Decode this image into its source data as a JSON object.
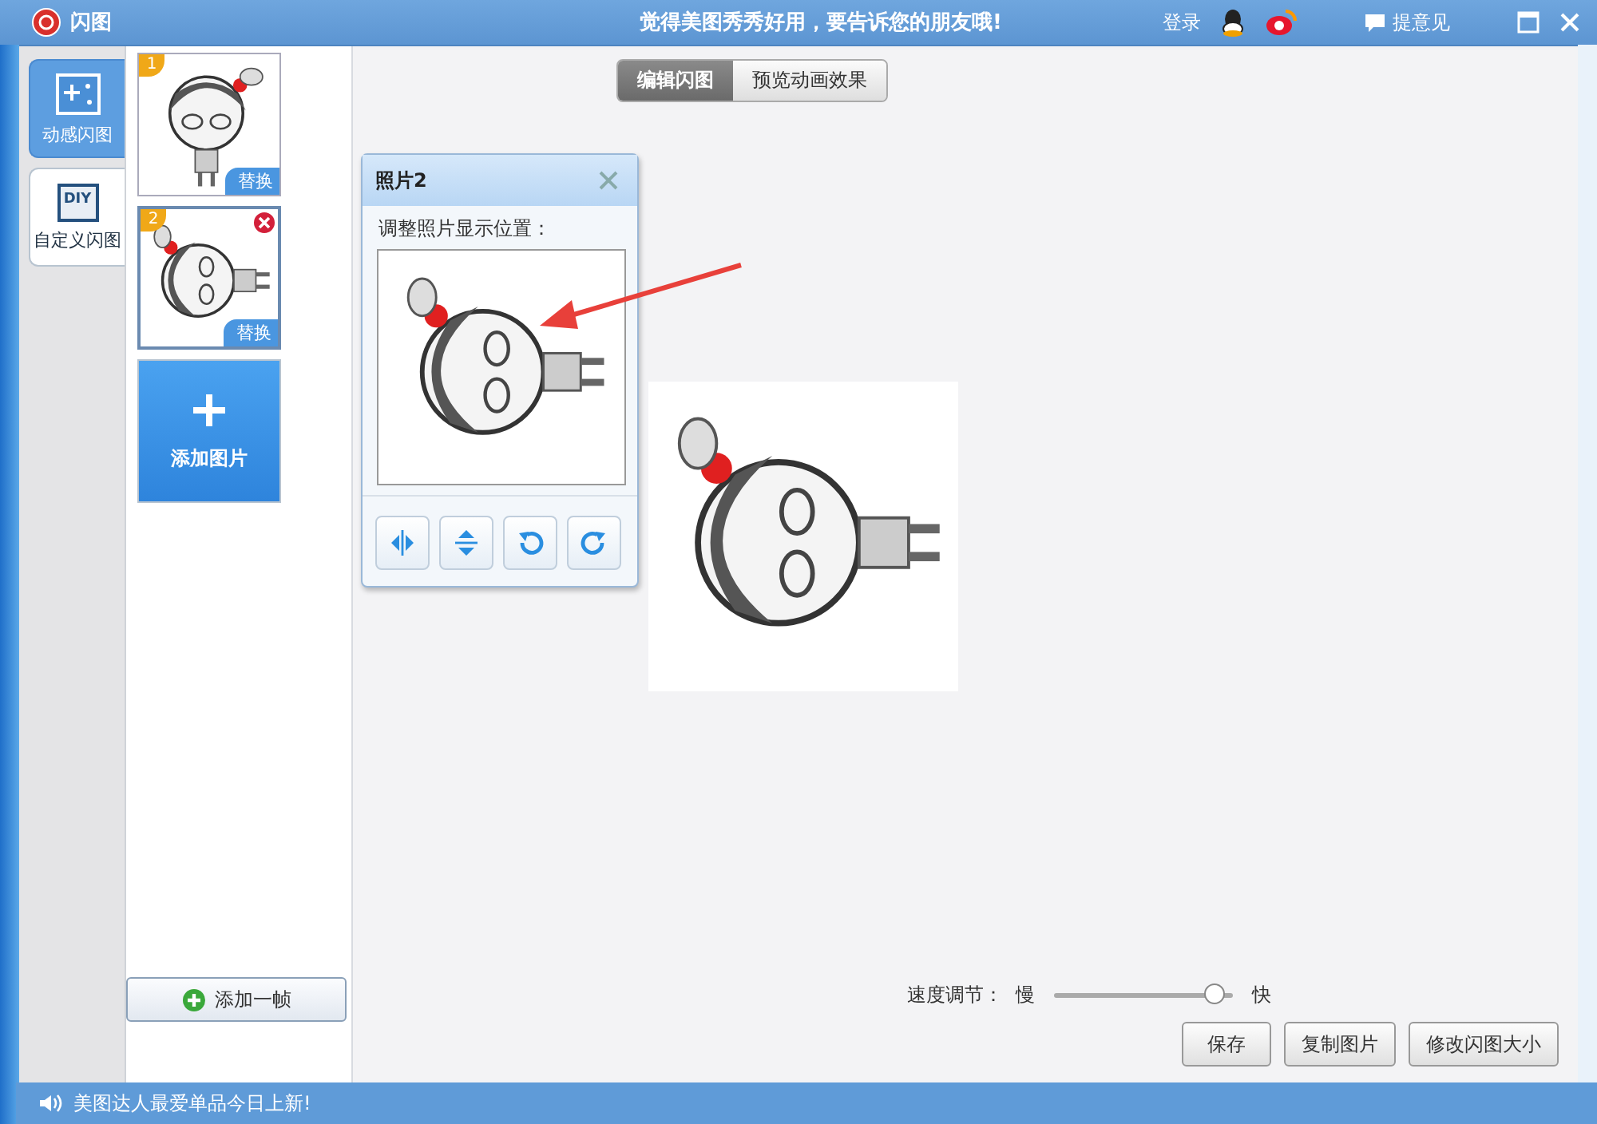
{
  "window": {
    "title": "闪图",
    "slogan": "觉得美图秀秀好用，要告诉您的朋友哦!",
    "login": "登录",
    "feedback": "提意见"
  },
  "mode_tabs": [
    {
      "label": "动感闪图",
      "selected": true,
      "kind": "sparkle"
    },
    {
      "label": "自定义闪图",
      "selected": false,
      "kind": "diy",
      "icon_text": "DIY"
    }
  ],
  "frames": [
    {
      "number": "1",
      "replace": "替换",
      "selected": false
    },
    {
      "number": "2",
      "replace": "替换",
      "selected": true
    }
  ],
  "add_image": "添加图片",
  "add_frame": "添加一帧",
  "view_tabs": [
    {
      "label": "编辑闪图",
      "selected": true
    },
    {
      "label": "预览动画效果",
      "selected": false
    }
  ],
  "photo_panel": {
    "title": "照片2",
    "instruction": "调整照片显示位置："
  },
  "speed": {
    "label": "速度调节：",
    "slow": "慢",
    "fast": "快",
    "level": 0.9
  },
  "buttons": [
    "保存",
    "复制图片",
    "修改闪图大小"
  ],
  "status_bar": "美图达人最爱单品今日上新!"
}
